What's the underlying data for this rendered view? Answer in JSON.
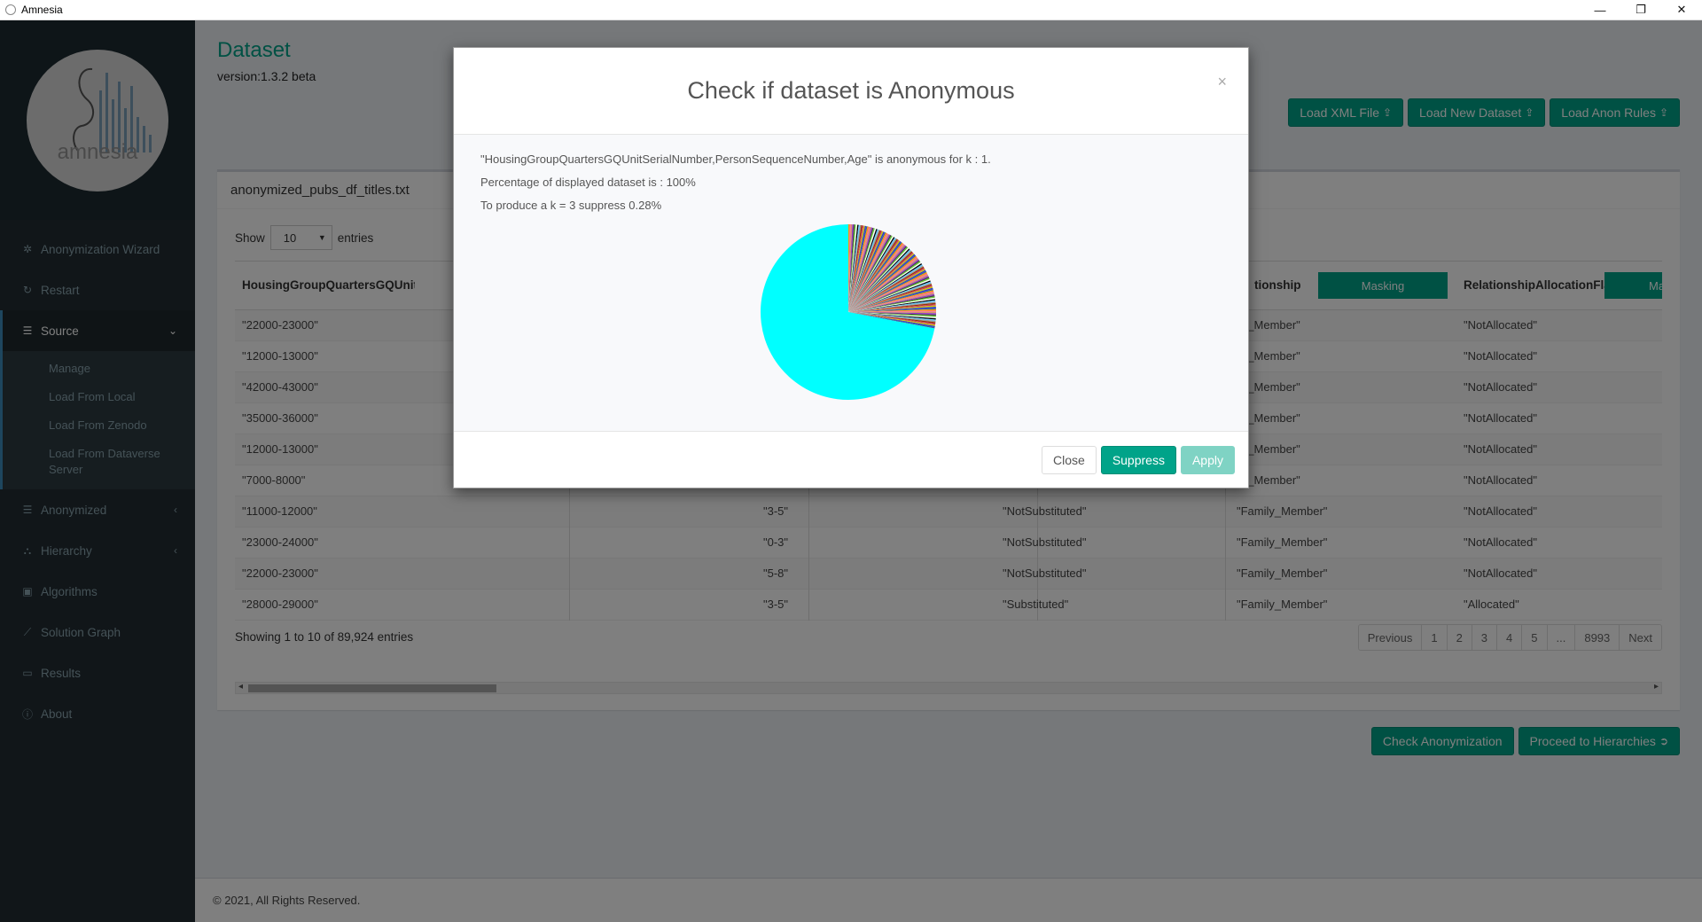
{
  "window": {
    "title": "Amnesia",
    "controls": [
      "—",
      "❐",
      "✕"
    ]
  },
  "sidebar": {
    "logo_text": "amnesia",
    "items": [
      {
        "label": "Anonymization Wizard",
        "icon": "magic-icon"
      },
      {
        "label": "Restart",
        "icon": "refresh-icon"
      },
      {
        "label": "Source",
        "icon": "database-icon",
        "caret": "⌄"
      },
      {
        "label": "Anonymized",
        "icon": "database-icon",
        "caret": "‹"
      },
      {
        "label": "Hierarchy",
        "icon": "sitemap-icon",
        "caret": "‹"
      },
      {
        "label": "Algorithms",
        "icon": "lock-icon"
      },
      {
        "label": "Solution Graph",
        "icon": "line-chart-icon"
      },
      {
        "label": "Results",
        "icon": "laptop-icon"
      },
      {
        "label": "About",
        "icon": "info-icon"
      }
    ],
    "source_sub": [
      "Manage",
      "Load From Local",
      "Load From Zenodo",
      "Load From Dataverse Server"
    ]
  },
  "header": {
    "title": "Dataset",
    "version": "version:1.3.2 beta",
    "buttons": [
      "Load XML File",
      "Load New Dataset",
      "Load Anon Rules"
    ]
  },
  "dataset": {
    "file_name": "anonymized_pubs_df_titles.txt",
    "show_label": "Show",
    "entries_value": "10",
    "entries_label": "entries",
    "columns": {
      "c1": "HousingGroupQuartersGQUnitSerial",
      "c4": "tionship",
      "c4_btn": "Masking",
      "c5": "RelationshipAllocationFlag",
      "c5_btn": "Ma"
    },
    "rows": [
      {
        "c1": "\"22000-23000\"",
        "c2": "",
        "c3": "",
        "c4": "ily_Member\"",
        "c5": "\"NotAllocated\""
      },
      {
        "c1": "\"12000-13000\"",
        "c2": "",
        "c3": "",
        "c4": "ily_Member\"",
        "c5": "\"NotAllocated\""
      },
      {
        "c1": "\"42000-43000\"",
        "c2": "",
        "c3": "",
        "c4": "ily_Member\"",
        "c5": "\"NotAllocated\""
      },
      {
        "c1": "\"35000-36000\"",
        "c2": "",
        "c3": "",
        "c4": "ily_Member\"",
        "c5": "\"NotAllocated\""
      },
      {
        "c1": "\"12000-13000\"",
        "c2": "",
        "c3": "",
        "c4": "ily_Member\"",
        "c5": "\"NotAllocated\""
      },
      {
        "c1": "\"7000-8000\"",
        "c2": "",
        "c3": "",
        "c4": "ily_Member\"",
        "c5": "\"NotAllocated\""
      },
      {
        "c1": "\"11000-12000\"",
        "c2": "\"3-5\"",
        "c3": "\"NotSubstituted\"",
        "c4": "\"Family_Member\"",
        "c5": "\"NotAllocated\""
      },
      {
        "c1": "\"23000-24000\"",
        "c2": "\"0-3\"",
        "c3": "\"NotSubstituted\"",
        "c4": "\"Family_Member\"",
        "c5": "\"NotAllocated\""
      },
      {
        "c1": "\"22000-23000\"",
        "c2": "\"5-8\"",
        "c3": "\"NotSubstituted\"",
        "c4": "\"Family_Member\"",
        "c5": "\"NotAllocated\""
      },
      {
        "c1": "\"28000-29000\"",
        "c2": "\"3-5\"",
        "c3": "\"Substituted\"",
        "c4": "\"Family_Member\"",
        "c5": "\"Allocated\""
      }
    ],
    "info": "Showing 1 to 10 of 89,924 entries",
    "pagination": [
      "Previous",
      "1",
      "2",
      "3",
      "4",
      "5",
      "...",
      "8993",
      "Next"
    ]
  },
  "actions": {
    "check": "Check Anonymization",
    "proceed": "Proceed to Hierarchies"
  },
  "footer": "© 2021, All Rights Reserved.",
  "modal": {
    "title": "Check if dataset is Anonymous",
    "close_x": "×",
    "line1": "\"HousingGroupQuartersGQUnitSerialNumber,PersonSequenceNumber,Age\" is anonymous for k : 1.",
    "line2": "Percentage of displayed dataset is : 100%",
    "line3": "To produce a k = 3 suppress 0.28%",
    "buttons": {
      "close": "Close",
      "suppress": "Suppress",
      "apply": "Apply"
    }
  },
  "chart_data": {
    "type": "pie",
    "title": "",
    "dominant_slice": {
      "fraction": 0.72,
      "color": "#00ffff"
    },
    "remaining_slices_count": 120,
    "remaining_fraction": 0.28,
    "start_angle_deg": 0,
    "colors": [
      "#ff9900",
      "#3333cc",
      "#cc3366",
      "#999999",
      "#000000",
      "#66cc33",
      "#9933cc",
      "#ff6699",
      "#336699",
      "#cccc00",
      "#993300",
      "#66ccff",
      "#ffffff",
      "#444444",
      "#cc9966"
    ]
  }
}
